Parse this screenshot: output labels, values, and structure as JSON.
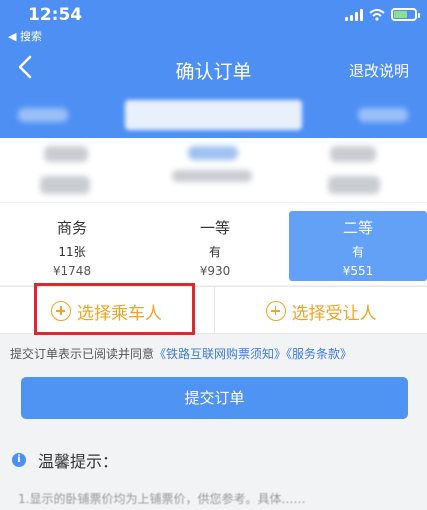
{
  "status_bar": {
    "time": "12:54",
    "back_app": "◀ 搜索"
  },
  "nav": {
    "title": "确认订单",
    "rules_label": "退改说明"
  },
  "seats": [
    {
      "name": "商务",
      "count": "11张",
      "price": "¥1748",
      "selected": false
    },
    {
      "name": "一等",
      "count": "有",
      "price": "¥930",
      "selected": false
    },
    {
      "name": "二等",
      "count": "有",
      "price": "¥551",
      "selected": true
    }
  ],
  "actions": {
    "select_passenger": "选择乘车人",
    "select_transferee": "选择受让人"
  },
  "notice": {
    "prefix": "提交订单表示已阅读并同意",
    "link1": "《铁路互联网购票须知》",
    "link2": "《服务条款》"
  },
  "submit_label": "提交订单",
  "tips": {
    "title": "温馨提示：",
    "footnote": "1.显示的卧铺票价均为上铺票价，供您参考。具体……"
  },
  "colors": {
    "brand_blue": "#4e8ff4",
    "accent_orange": "#f2a322",
    "highlight_red": "#e0262e"
  }
}
